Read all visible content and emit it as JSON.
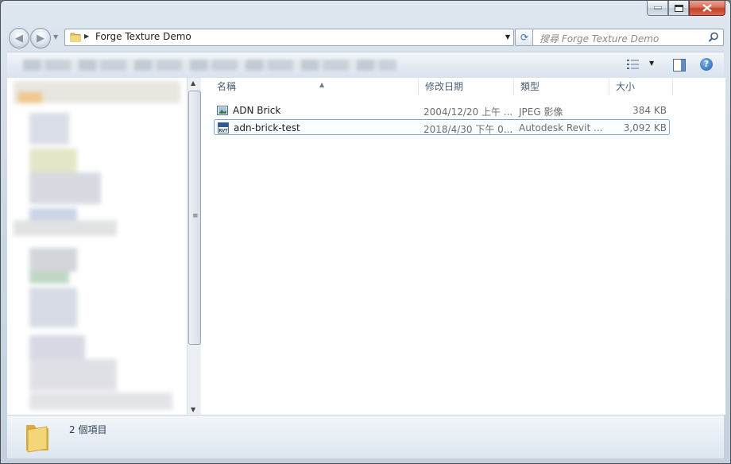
{
  "window": {
    "caption_min": "—",
    "caption_max": "▫",
    "caption_close": "✕"
  },
  "address": {
    "path_segment": "Forge Texture Demo"
  },
  "search": {
    "placeholder": "搜尋 Forge Texture Demo"
  },
  "file_list": {
    "columns": [
      "名稱",
      "修改日期",
      "類型",
      "大小"
    ],
    "rows": [
      {
        "name": "ADN Brick",
        "modified": "2004/12/20 上午 ...",
        "type": "JPEG 影像",
        "size": "384 KB",
        "icon": "image-file-icon"
      },
      {
        "name": "adn-brick-test",
        "modified": "2018/4/30 下午 0...",
        "type": "Autodesk Revit ...",
        "size": "3,092 KB",
        "icon": "rvt-file-icon"
      }
    ]
  },
  "status": {
    "item_count": "2 個項目"
  },
  "colors": {
    "accent": "#1d5fb2",
    "header_text": "#4c607a",
    "selection_border": "#7da2ce"
  }
}
